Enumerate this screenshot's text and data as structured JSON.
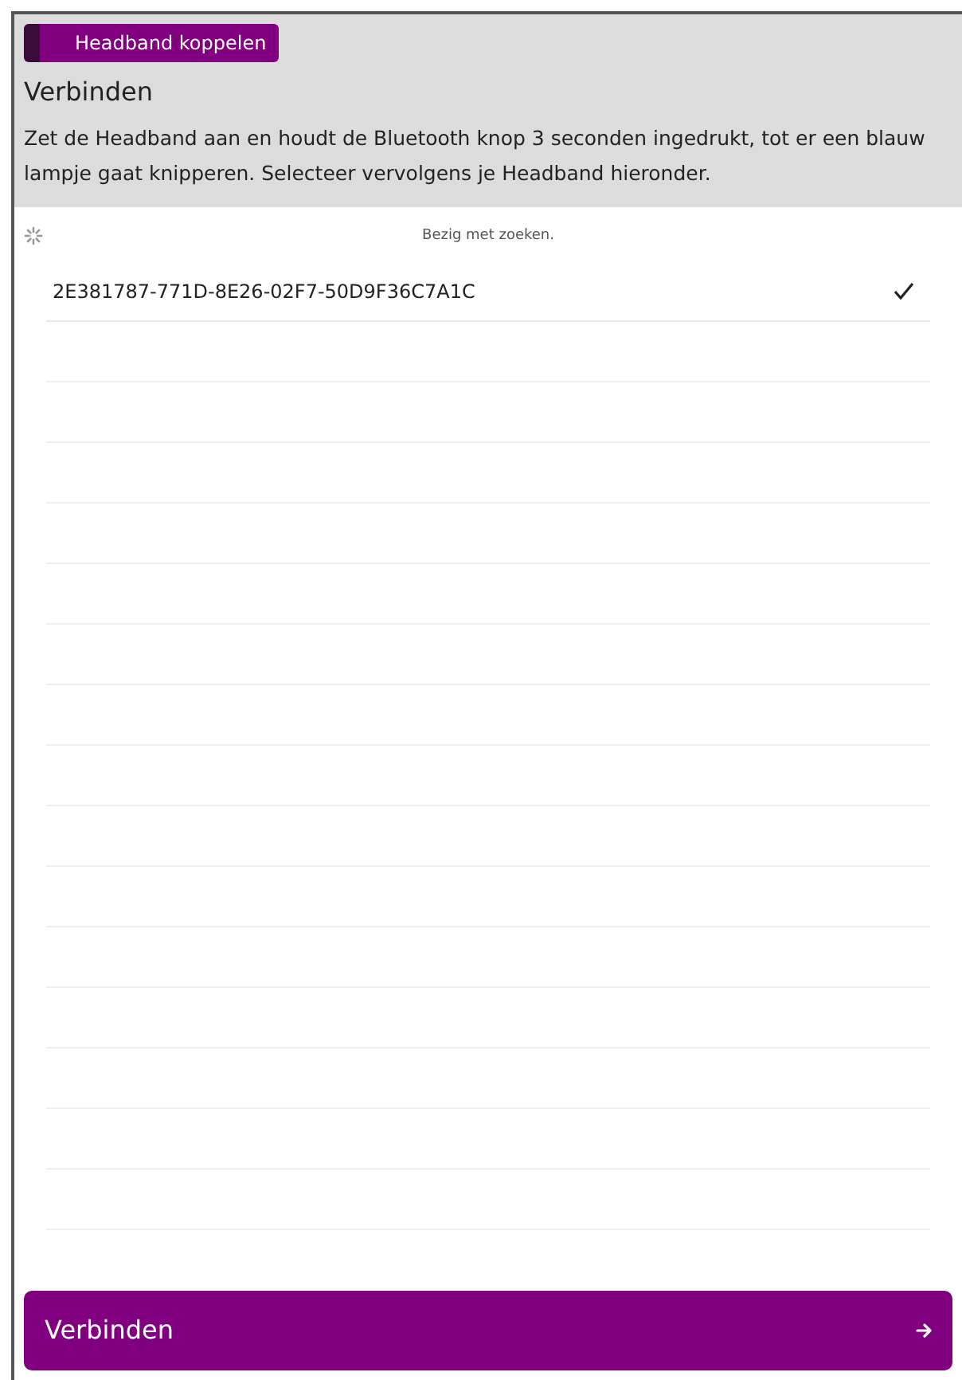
{
  "header": {
    "badge": "Headband koppelen",
    "title": "Verbinden",
    "instructions": "Zet de Headband aan en houdt de Bluetooth knop 3 seconden ingedrukt, tot er een blauw lampje gaat knipperen. Selecteer vervolgens je Headband hieronder."
  },
  "search_status": "Bezig met zoeken.",
  "devices": [
    {
      "name": "2E381787-771D-8E26-02F7-50D9F36C7A1C",
      "selected": true
    }
  ],
  "connect_button": {
    "label": "Verbinden"
  }
}
